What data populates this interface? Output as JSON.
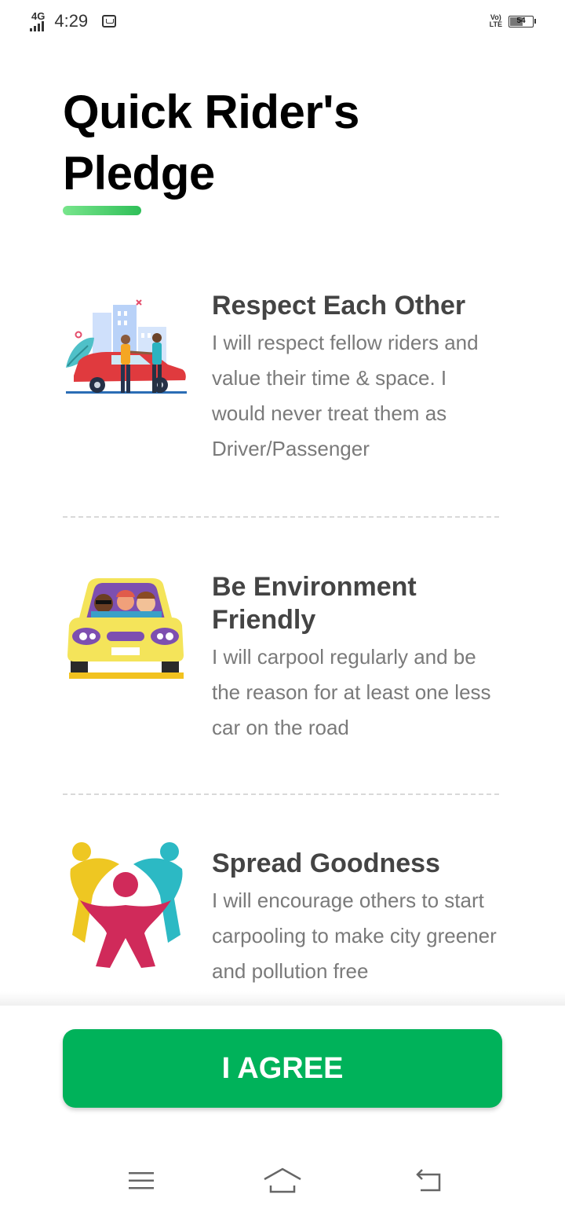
{
  "status_bar": {
    "network": "4G",
    "time": "4:29",
    "volte": "VoLTE",
    "battery": "54"
  },
  "title": "Quick Rider's Pledge",
  "pledges": [
    {
      "heading": "Respect Each Other",
      "description": "I will respect fellow riders and value their time & space. I would never treat them as Driver/Passenger",
      "icon": "handshake-car-illustration"
    },
    {
      "heading": "Be Environment Friendly",
      "description": "I will carpool regularly and be the reason for at least one less car on the road",
      "icon": "carpool-car-illustration"
    },
    {
      "heading": "Spread Goodness",
      "description": "I will encourage others to start carpooling to make city greener and pollution free",
      "icon": "people-community-illustration"
    }
  ],
  "agree_button": "I AGREE",
  "colors": {
    "accent": "#00b25a",
    "underline_start": "#78e58c",
    "underline_end": "#2fbf58",
    "heading": "#444444",
    "body_text": "#7a7a7a"
  },
  "nav_icons": [
    "menu-icon",
    "home-icon",
    "back-icon"
  ]
}
